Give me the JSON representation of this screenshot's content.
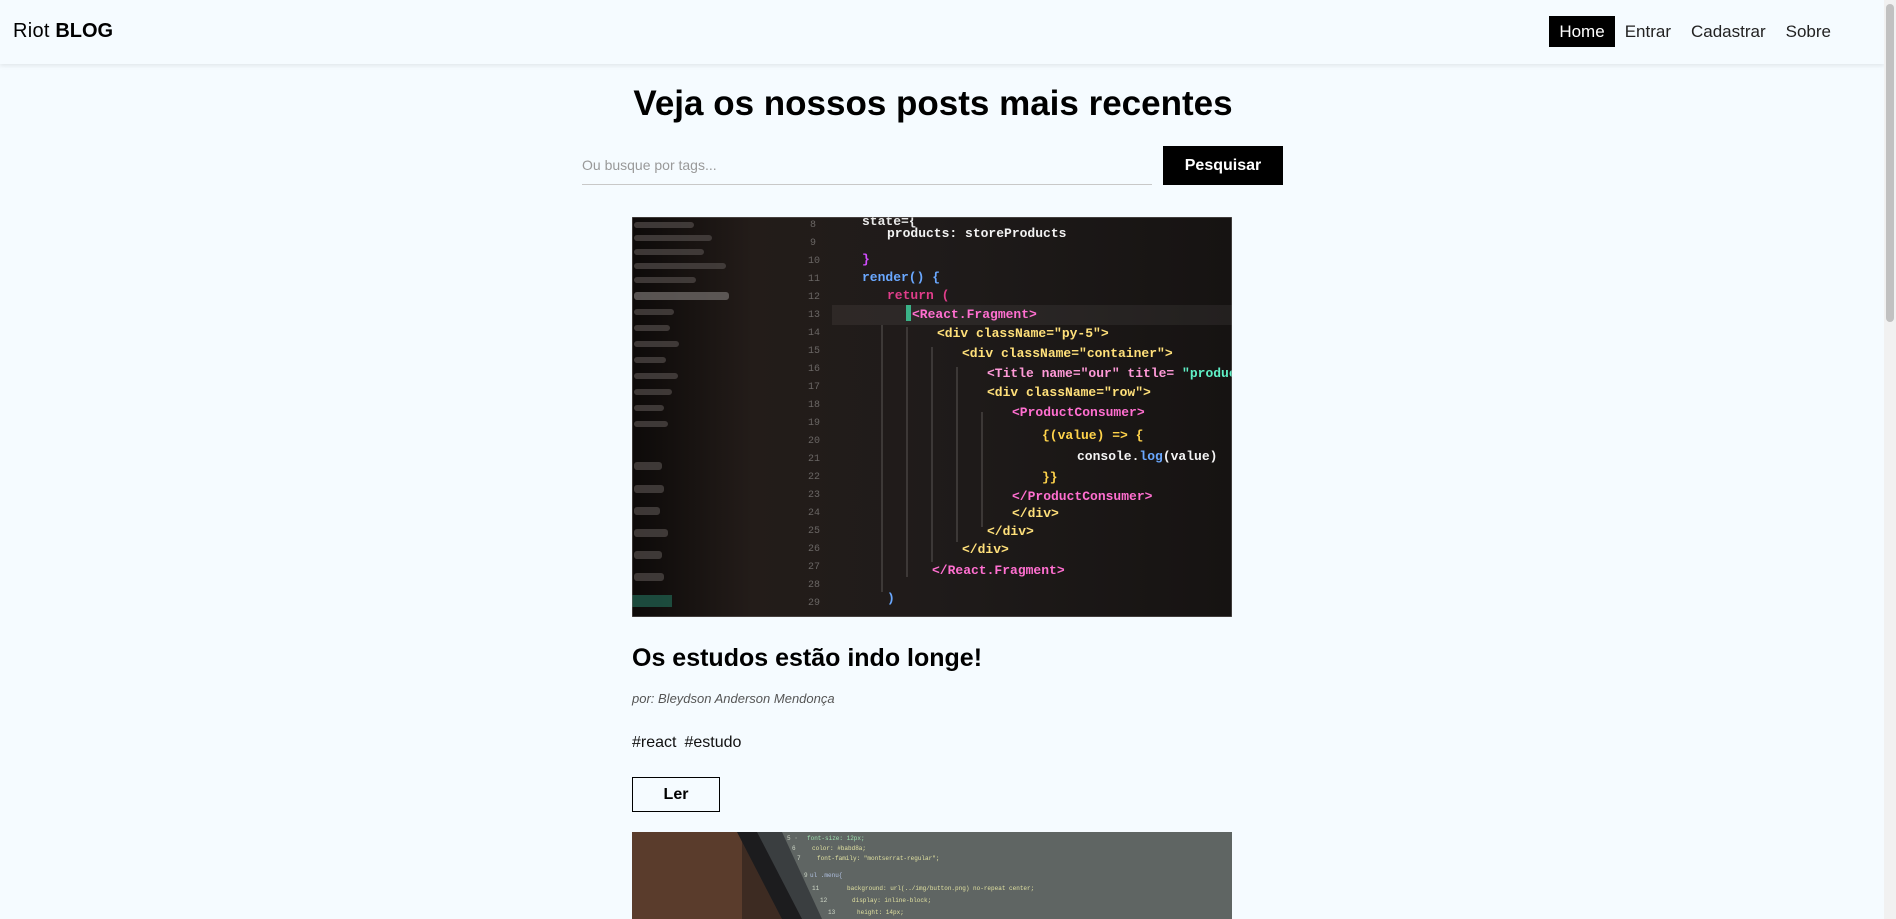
{
  "brand": {
    "light": "Riot",
    "bold": "BLOG"
  },
  "nav": [
    {
      "label": "Home",
      "active": true
    },
    {
      "label": "Entrar",
      "active": false
    },
    {
      "label": "Cadastrar",
      "active": false
    },
    {
      "label": "Sobre",
      "active": false
    }
  ],
  "page_title": "Veja os nossos posts mais recentes",
  "search": {
    "placeholder": "Ou busque por tags...",
    "button_label": "Pesquisar"
  },
  "posts": [
    {
      "title": "Os estudos estão indo longe!",
      "author": "por: Bleydson Anderson Mendonça",
      "tags": [
        "#react",
        "#estudo"
      ],
      "read_label": "Ler",
      "image": {
        "code_lines": [
          "state={",
          "products: storeProducts",
          "}",
          "render() {",
          "return (",
          "<React.Fragment>",
          "<div className=\"py-5\">",
          "<div className=\"container\">",
          "<Title name=\"our\" title= \"product",
          "<div className=\"row\">",
          "<ProductConsumer>",
          "{(value) => {",
          "console.log(value)",
          "}}",
          "</ProductConsumer>",
          "</div>",
          "</div>",
          "</div>",
          "</React.Fragment>"
        ]
      }
    }
  ],
  "colors": {
    "background": "#f5fbff",
    "accent": "#000000",
    "nav_active_text": "#ffffff"
  }
}
